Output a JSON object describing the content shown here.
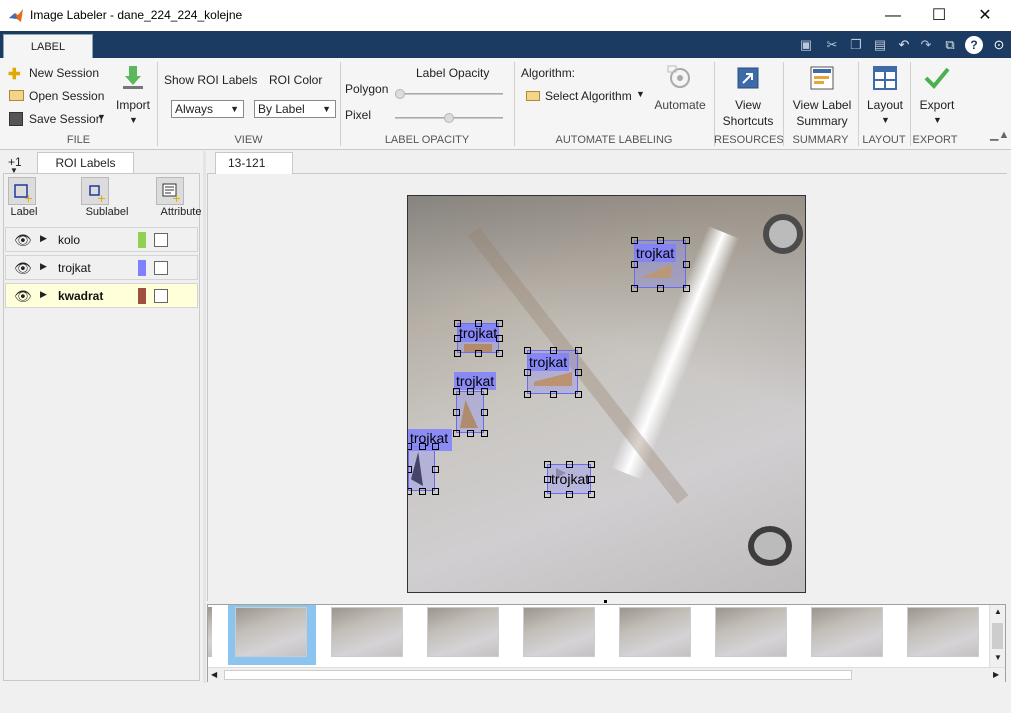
{
  "window": {
    "title": "Image Labeler - dane_224_224_kolejne",
    "minimize": "—",
    "maximize": "☐",
    "close": "✕"
  },
  "tabs": {
    "label_tab": "LABEL"
  },
  "toolstrip": {
    "file": {
      "new_session": "New Session",
      "open_session": "Open Session",
      "save_session": "Save Session",
      "import": "Import",
      "section": "FILE"
    },
    "view": {
      "show_roi_labels": "Show ROI Labels",
      "roi_color": "ROI Color",
      "show_roi_value": "Always",
      "roi_color_value": "By Label",
      "section": "VIEW"
    },
    "label_opacity": {
      "title": "Label Opacity",
      "polygon": "Polygon",
      "pixel": "Pixel",
      "section": "LABEL OPACITY",
      "polygon_level": 0,
      "pixel_level": 0.5
    },
    "automate": {
      "algorithm": "Algorithm:",
      "select_algorithm": "Select Algorithm",
      "automate": "Automate",
      "section": "AUTOMATE LABELING"
    },
    "resources": {
      "view": "View",
      "shortcuts": "Shortcuts",
      "section": "RESOURCES"
    },
    "summary": {
      "line1": "View Label",
      "line2": "Summary",
      "section": "SUMMARY"
    },
    "layout": {
      "label": "Layout",
      "section": "LAYOUT"
    },
    "export": {
      "label": "Export",
      "section": "EXPORT"
    }
  },
  "left_panel": {
    "plus_one": "+1",
    "tab": "ROI Labels",
    "buttons": {
      "label": "Label",
      "sublabel": "Sublabel",
      "attribute": "Attribute"
    },
    "labels": [
      {
        "name": "kolo",
        "color": "#92d050"
      },
      {
        "name": "trojkat",
        "color": "#8080ff"
      },
      {
        "name": "kwadrat",
        "color": "#9e5040"
      }
    ]
  },
  "document": {
    "tab": "13-121",
    "annotations": [
      "trojkat",
      "trojkat",
      "trojkat",
      "trojkat",
      "trojkat",
      "trojkat"
    ]
  },
  "colors": {
    "titlebar_tab_strip": "#1b3b62",
    "roi_box": "#8080ff",
    "thumb_selection": "#8cc4f0"
  }
}
